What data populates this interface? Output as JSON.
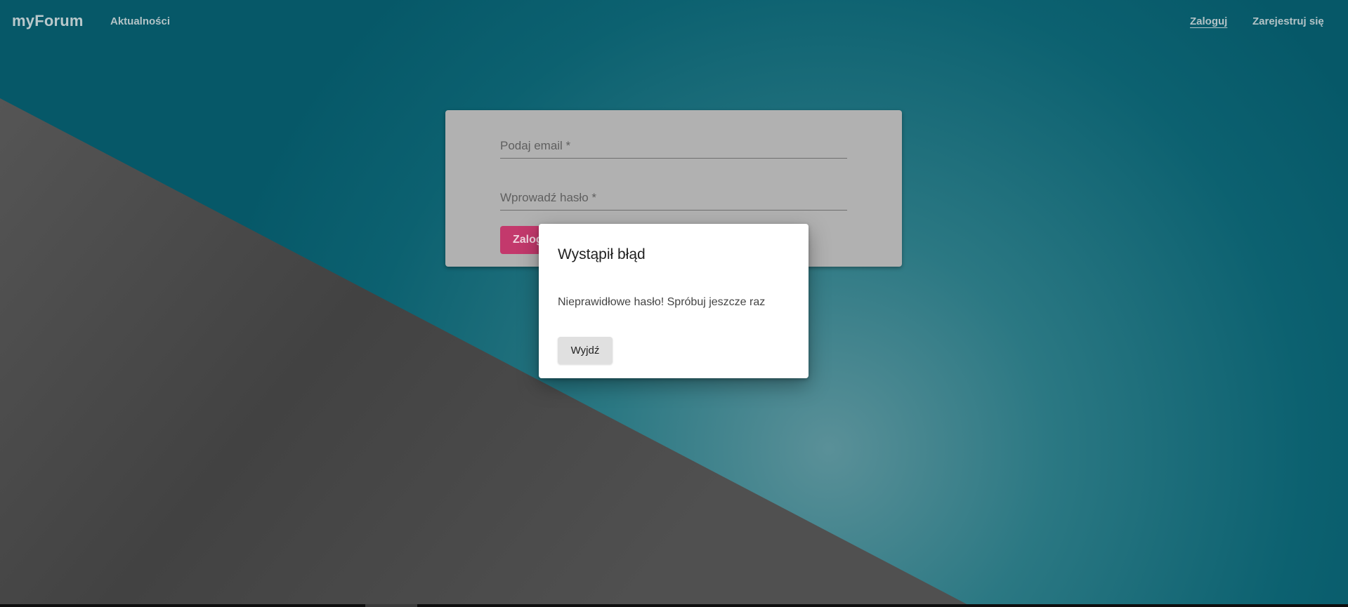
{
  "navbar": {
    "brand": "myForum",
    "links": {
      "news": "Aktualności",
      "login": "Zaloguj",
      "register": "Zarejestruj się"
    }
  },
  "login_form": {
    "email_label": "Podaj email *",
    "password_label": "Wprowadź hasło *",
    "submit_label": "Zaloguj"
  },
  "error_dialog": {
    "title": "Wystąpił błąd",
    "message": "Nieprawidłowe hasło! Spróbuj jeszcze raz",
    "exit_label": "Wyjdź"
  },
  "colors": {
    "background_teal": "#0d5e6e",
    "background_gray": "#4a4a4a",
    "accent_pink": "#c3396c",
    "card_gray": "#b1b1b1"
  }
}
